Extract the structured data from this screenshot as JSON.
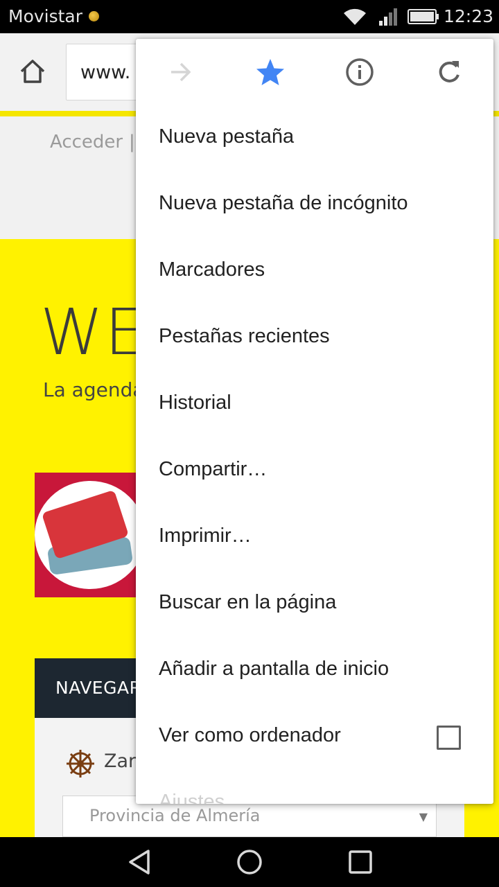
{
  "status_bar": {
    "carrier": "Movistar",
    "time": "12:23",
    "icons": [
      "wifi-icon",
      "signal-icon",
      "battery-icon"
    ]
  },
  "toolbar": {
    "url_partial": "www.",
    "icons": [
      "home-icon"
    ]
  },
  "page": {
    "login_link": "Acceder",
    "separator": "|",
    "logo_text": "WE",
    "tagline": "La agenda",
    "nav_label": "NAVEGAR",
    "filter_label": "Zarp",
    "province_select": "Provincia de Almería",
    "accent_color": "#fff200"
  },
  "menu": {
    "top_icons": [
      "forward-arrow-icon",
      "bookmark-star-icon",
      "info-icon",
      "reload-icon"
    ],
    "items": [
      {
        "label": "Nueva pestaña"
      },
      {
        "label": "Nueva pestaña de incógnito"
      },
      {
        "label": "Marcadores"
      },
      {
        "label": "Pestañas recientes"
      },
      {
        "label": "Historial"
      },
      {
        "label": "Compartir…"
      },
      {
        "label": "Imprimir…"
      },
      {
        "label": "Buscar en la página"
      },
      {
        "label": "Añadir a pantalla de inicio"
      },
      {
        "label": "Ver como ordenador",
        "checked": false
      },
      {
        "label": "Ajustes"
      }
    ],
    "star_color": "#4285f4"
  },
  "nav_buttons": [
    "back-icon",
    "home-circle-icon",
    "recents-icon"
  ]
}
